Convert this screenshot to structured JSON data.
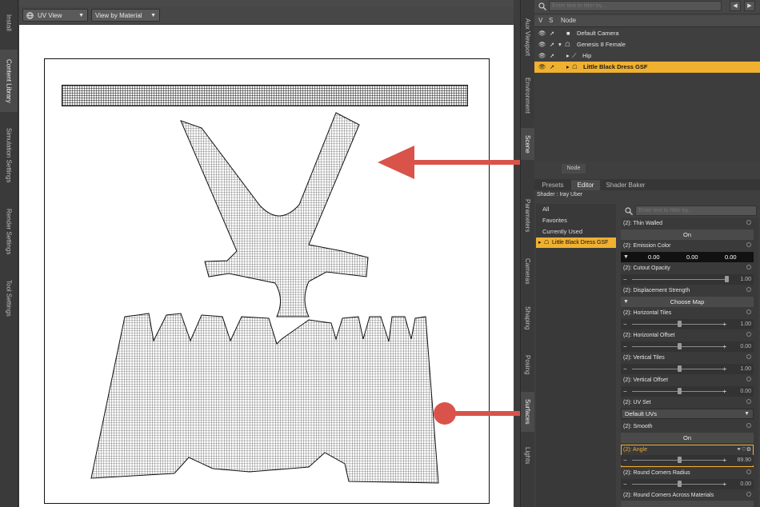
{
  "colors": {
    "accent": "#f0a830",
    "arrow": "#d9534a",
    "selected_row": "#f0b030"
  },
  "left_tabs": [
    "Install",
    "Content Library",
    "Simulation Settings",
    "Render Settings",
    "Tool Settings"
  ],
  "viewport": {
    "view_label": "UV View",
    "material_label": "View by Material"
  },
  "mid_tabs": [
    "Aux Viewport",
    "Environment",
    "Scene",
    "Parameters",
    "Cameras",
    "Shaping",
    "Posing",
    "Surfaces",
    "Lights"
  ],
  "scene": {
    "filter_placeholder": "Enter text to filter by...",
    "col_v": "V",
    "col_s": "S",
    "col_node": "Node",
    "nodes": [
      {
        "label": "Default Camera",
        "selected": false
      },
      {
        "label": "Genesis 8 Female",
        "selected": false
      },
      {
        "label": "Hip",
        "selected": false
      },
      {
        "label": "Little Black Dress GSF",
        "selected": true
      }
    ],
    "bottom_tab": "Node"
  },
  "surfaces": {
    "tabs": [
      "Presets",
      "Editor",
      "Shader Baker"
    ],
    "active_tab": "Editor",
    "shader_label": "Shader : Iray Uber",
    "filter_placeholder": "Enter text to filter by...",
    "tree": [
      "All",
      "Favorites",
      "Currently Used",
      "Little Black Dress GSF"
    ],
    "props": {
      "thin_walled": {
        "label": "(2): Thin Walled",
        "value": "On"
      },
      "emission": {
        "label": "(2): Emission Color",
        "r": "0.00",
        "g": "0.00",
        "b": "0.00"
      },
      "cutout": {
        "label": "(2): Cutout Opacity",
        "value": "1.00",
        "level": 1.0
      },
      "displacement": {
        "label": "(2): Displacement Strength",
        "value": "Choose Map"
      },
      "h_tiles": {
        "label": "(2): Horizontal Tiles",
        "value": "1.00",
        "level": 0.5
      },
      "h_offset": {
        "label": "(2): Horizontal Offset",
        "value": "0.00",
        "level": 0.5
      },
      "v_tiles": {
        "label": "(2): Vertical Tiles",
        "value": "1.00",
        "level": 0.5
      },
      "v_offset": {
        "label": "(2): Vertical Offset",
        "value": "0.00",
        "level": 0.5
      },
      "uv_set": {
        "label": "(2): UV Set",
        "value": "Default UVs"
      },
      "smooth": {
        "label": "(2): Smooth",
        "value": "On"
      },
      "angle": {
        "label": "(2): Angle",
        "value": "89.90",
        "level": 0.5
      },
      "rc_radius": {
        "label": "(2): Round Corners Radius",
        "value": "0.00",
        "level": 0.5
      },
      "rc_across": {
        "label": "(2): Round Corners Across Materials"
      }
    }
  }
}
